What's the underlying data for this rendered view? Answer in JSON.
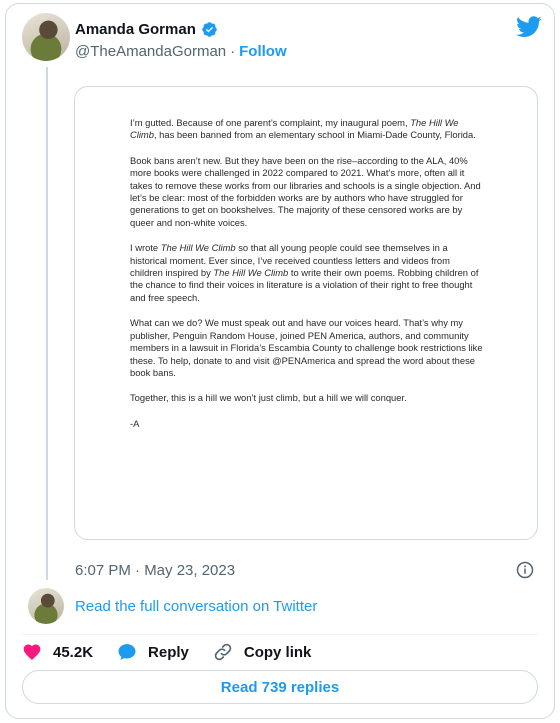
{
  "author": {
    "display_name": "Amanda Gorman",
    "handle": "@TheAmandaGorman",
    "separator": "·",
    "follow_label": "Follow",
    "verified": true,
    "brand_color": "#1d9bf0"
  },
  "letter": {
    "paragraphs": [
      {
        "parts": [
          {
            "t": "I’m gutted. Because of one parent’s complaint, my inaugural poem, "
          },
          {
            "t": "The Hill We Climb",
            "i": true
          },
          {
            "t": ", has been banned from an elementary school in Miami-Dade County, Florida."
          }
        ]
      },
      {
        "parts": [
          {
            "t": "Book bans aren’t new. But they have been on the rise–according to the ALA, 40% more books were challenged in 2022 compared to 2021. What’s more, often all it takes to remove these works from our libraries and schools is a single objection. And let’s be clear: most of the forbidden works are by authors who have struggled for generations to get on bookshelves. The majority of these censored works are by queer and non-white voices."
          }
        ]
      },
      {
        "parts": [
          {
            "t": "I wrote "
          },
          {
            "t": "The Hill We Climb",
            "i": true
          },
          {
            "t": " so that all young people could see themselves in a historical moment. Ever since, I’ve received countless letters and videos from children inspired by "
          },
          {
            "t": "The Hill We Climb",
            "i": true
          },
          {
            "t": " to write their own poems. Robbing children of the chance to find their voices in literature is a violation of their right to free thought and free speech."
          }
        ]
      },
      {
        "parts": [
          {
            "t": "What can we do? We must speak out and have our voices heard. That’s why my publisher, Penguin Random House, joined PEN America, authors, and community members in a lawsuit in Florida’s Escambia County to challenge book restrictions like these. To help, donate to and visit @PENAmerica and spread the word about these book bans."
          }
        ]
      },
      {
        "parts": [
          {
            "t": "Together, this is a hill we won’t just climb, but a hill we will conquer."
          }
        ]
      },
      {
        "parts": [
          {
            "t": "-A"
          }
        ]
      }
    ]
  },
  "timestamp": "6:07 PM · May 23, 2023",
  "read_full_label": "Read the full conversation on Twitter",
  "actions": {
    "likes_count": "45.2K",
    "reply_label": "Reply",
    "copy_link_label": "Copy link",
    "like_color": "#f91880"
  },
  "read_replies_label": "Read 739 replies",
  "icons": {
    "logo": "twitter-bird-icon",
    "verified": "verified-badge-icon",
    "info": "info-icon",
    "like": "heart-icon",
    "reply": "speech-bubble-icon",
    "copy": "link-icon"
  }
}
